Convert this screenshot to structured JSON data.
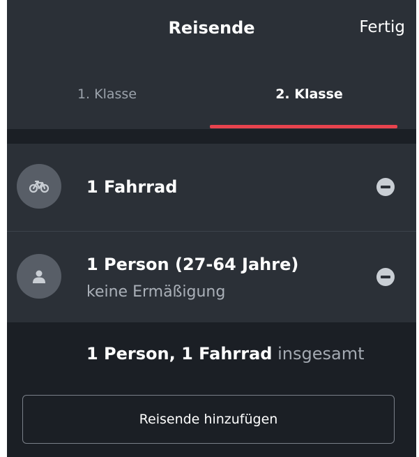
{
  "header": {
    "title": "Reisende",
    "done_label": "Fertig"
  },
  "tabs": [
    {
      "label": "1. Klasse",
      "selected": false
    },
    {
      "label": "2. Klasse",
      "selected": true
    }
  ],
  "accent_color": "#e8434e",
  "rows": [
    {
      "icon": "bicycle-icon",
      "label": "1 Fahrrad",
      "sub": ""
    },
    {
      "icon": "person-icon",
      "label": "1 Person (27-64 Jahre)",
      "sub": "keine Ermäßigung"
    }
  ],
  "summary": {
    "count_text": "1 Person, 1 Fahrrad",
    "suffix": "insgesamt"
  },
  "add_button_label": "Reisende hinzufügen"
}
